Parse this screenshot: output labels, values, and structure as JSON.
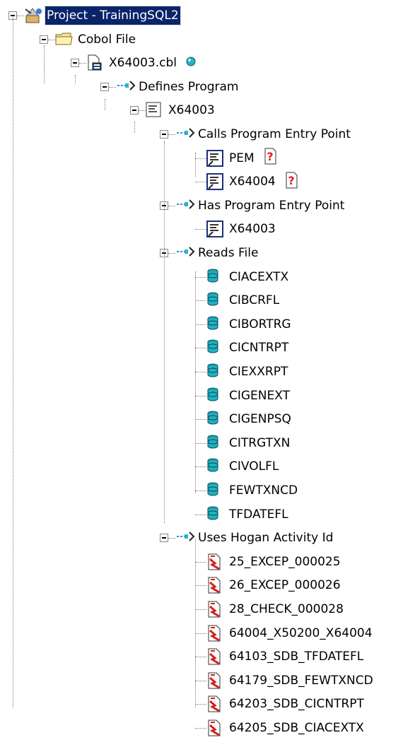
{
  "tree": {
    "root": {
      "label": "Project - TrainingSQL2",
      "icon": "project-icon",
      "selected": true
    },
    "folder": {
      "label": "Cobol File",
      "icon": "folder-icon"
    },
    "file": {
      "label": "X64003.cbl",
      "icon": "cobol-file-icon",
      "status_icon": "status-dot-icon"
    },
    "defines": {
      "label": "Defines Program",
      "icon": "relation-icon"
    },
    "program": {
      "label": "X64003",
      "icon": "program-icon"
    },
    "calls": {
      "label": "Calls Program Entry Point",
      "icon": "relation-icon",
      "items": [
        {
          "label": "PEM",
          "icon": "program-entry-icon",
          "badge": "unresolved-icon"
        },
        {
          "label": "X64004",
          "icon": "program-entry-icon",
          "badge": "unresolved-icon"
        }
      ]
    },
    "has_entry": {
      "label": "Has Program Entry Point",
      "icon": "relation-icon",
      "items": [
        {
          "label": "X64003",
          "icon": "program-entry-icon"
        }
      ]
    },
    "reads": {
      "label": "Reads File",
      "icon": "relation-icon",
      "items": [
        {
          "label": "CIACEXTX"
        },
        {
          "label": "CIBCRFL"
        },
        {
          "label": "CIBORTRG"
        },
        {
          "label": "CICNTRPT"
        },
        {
          "label": "CIEXXRPT"
        },
        {
          "label": "CIGENEXT"
        },
        {
          "label": "CIGENPSQ"
        },
        {
          "label": "CITRGTXN"
        },
        {
          "label": "CIVOLFL"
        },
        {
          "label": "FEWTXNCD"
        },
        {
          "label": "TFDATEFL"
        }
      ]
    },
    "hogan": {
      "label": "Uses Hogan Activity Id",
      "icon": "relation-icon",
      "items": [
        {
          "label": "25_EXCEP_000025"
        },
        {
          "label": "26_EXCEP_000026"
        },
        {
          "label": "28_CHECK_000028"
        },
        {
          "label": "64004_X50200_X64004"
        },
        {
          "label": "64103_SDB_TFDATEFL"
        },
        {
          "label": "64179_SDB_FEWTXNCD"
        },
        {
          "label": "64203_SDB_CICNTRPT"
        },
        {
          "label": "64205_SDB_CIACEXTX"
        }
      ]
    }
  },
  "colors": {
    "selection": "#0a246a",
    "datafile": "#2aa7b5",
    "activity": "#d42020"
  }
}
